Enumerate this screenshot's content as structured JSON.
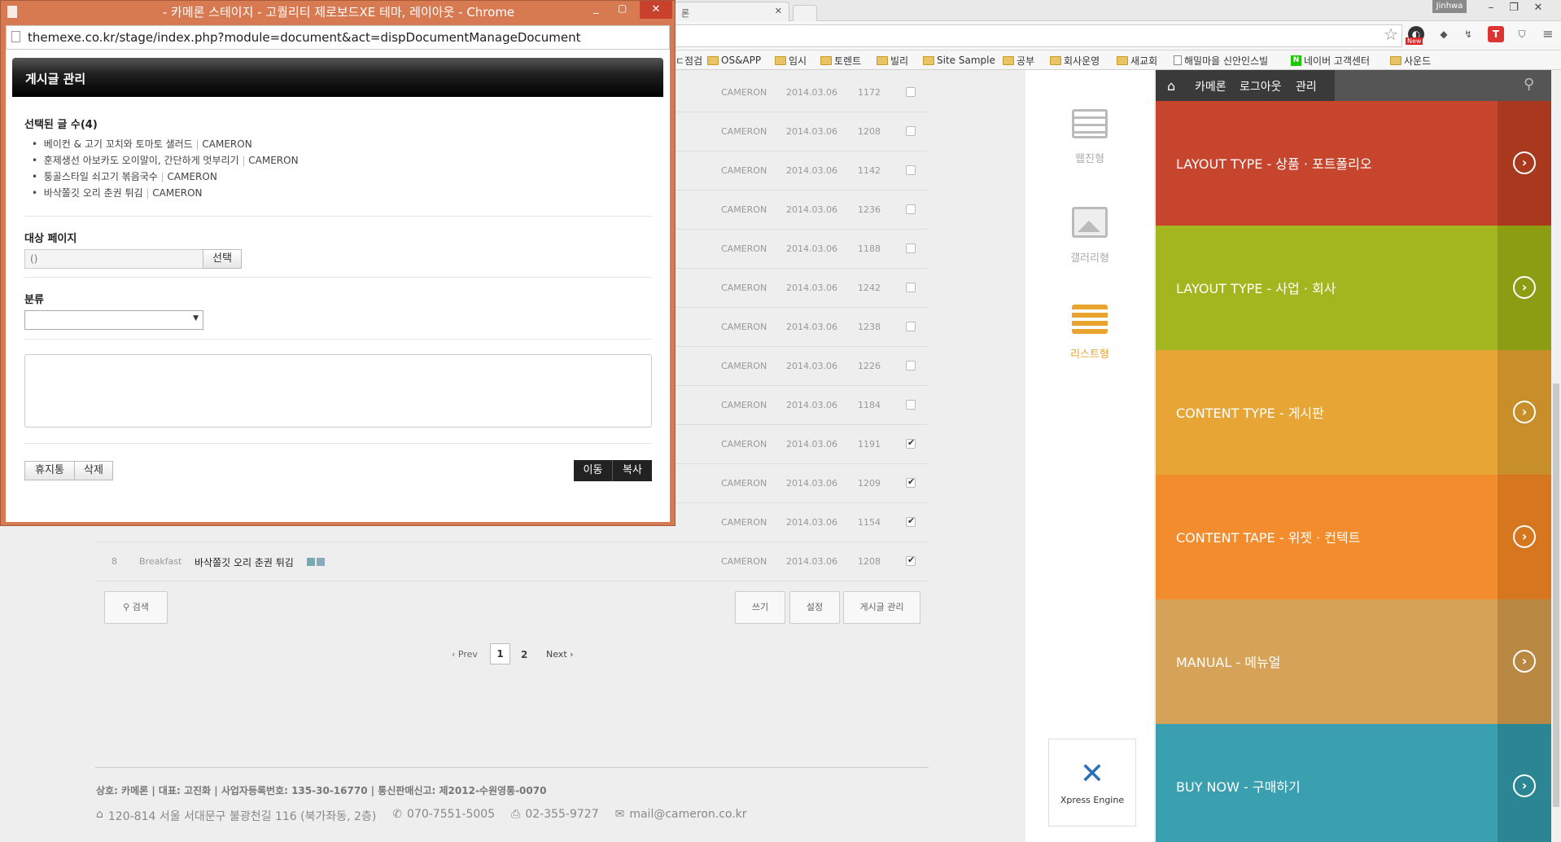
{
  "popup": {
    "window_title": "- 카메론 스테이지 - 고퀄리티 제로보드XE 테마, 레이아웃 - Chrome",
    "url": "themexe.co.kr/stage/index.php?module=document&act=dispDocumentManageDocument",
    "header": "게시글 관리",
    "selected_label": "선택된 글 수(4)",
    "selected_items": [
      {
        "title": "베이컨 & 고기 꼬치와 토마토 샐러드",
        "author": "CAMERON"
      },
      {
        "title": "훈제생선 아보카도 오이말이, 간단하게 멋부리기",
        "author": "CAMERON"
      },
      {
        "title": "퉁골스타일 쇠고기 볶음국수",
        "author": "CAMERON"
      },
      {
        "title": "바삭쫄깃 오리 춘권 튀김",
        "author": "CAMERON"
      }
    ],
    "target_label": "대상 페이지",
    "target_value": "()",
    "select_button": "선택",
    "category_label": "분류",
    "category_value": "",
    "textarea_value": "",
    "trash_button": "휴지통",
    "delete_button": "삭제",
    "move_button": "이동",
    "copy_button": "복사"
  },
  "browser": {
    "tab2_label": "론",
    "user_badge": "Jinhwa",
    "bookmarks": [
      "ㄷ점검",
      "OS&APP",
      "임시",
      "토렌트",
      "빌리",
      "Site Sample",
      "공부",
      "회사운영",
      "새교회",
      "해밀마을 신안인스빌",
      "네이버 고객센터",
      "사운드"
    ],
    "ext_badge": "New"
  },
  "board": {
    "rows": [
      {
        "author": "CAMERON",
        "date": "2014.03.06",
        "views": "1172",
        "checked": false
      },
      {
        "author": "CAMERON",
        "date": "2014.03.06",
        "views": "1208",
        "checked": false
      },
      {
        "author": "CAMERON",
        "date": "2014.03.06",
        "views": "1142",
        "checked": false
      },
      {
        "author": "CAMERON",
        "date": "2014.03.06",
        "views": "1236",
        "checked": false
      },
      {
        "author": "CAMERON",
        "date": "2014.03.06",
        "views": "1188",
        "checked": false
      },
      {
        "author": "CAMERON",
        "date": "2014.03.06",
        "views": "1242",
        "checked": false
      },
      {
        "author": "CAMERON",
        "date": "2014.03.06",
        "views": "1238",
        "checked": false
      },
      {
        "author": "CAMERON",
        "date": "2014.03.06",
        "views": "1226",
        "checked": false
      },
      {
        "author": "CAMERON",
        "date": "2014.03.06",
        "views": "1184",
        "checked": false
      },
      {
        "author": "CAMERON",
        "date": "2014.03.06",
        "views": "1191",
        "checked": true
      },
      {
        "author": "CAMERON",
        "date": "2014.03.06",
        "views": "1209",
        "checked": true
      },
      {
        "author": "CAMERON",
        "date": "2014.03.06",
        "views": "1154",
        "checked": true
      }
    ],
    "last_row": {
      "no": "8",
      "category": "Breakfast",
      "title": "바삭쫄깃 오리 춘권 튀김",
      "author": "CAMERON",
      "date": "2014.03.06",
      "views": "1208",
      "checked": true
    },
    "search_button": "검색",
    "write_button": "쓰기",
    "settings_button": "설정",
    "manage_button": "게시글 관리",
    "pager": {
      "prev": "‹ Prev",
      "pages": [
        "1",
        "2"
      ],
      "current": "1",
      "next": "Next ›"
    },
    "footer_line1": "상호: 카메론 | 대표: 고진화 | 사업자등록번호: 135-30-16770 | 통신판매신고: 제2012-수원영통-0070",
    "footer_address": "120-814 서울 서대문구 불광천길 116 (북가좌동, 2층)",
    "footer_phone": "070-7551-5005",
    "footer_fax": "02-355-9727",
    "footer_email": "mail@cameron.co.kr"
  },
  "side": {
    "items": [
      {
        "label": "웹진형"
      },
      {
        "label": "갤러리형"
      },
      {
        "label": "리스트형"
      }
    ],
    "xe_label": "Xpress Engine"
  },
  "right": {
    "nav": [
      "카메론",
      "로그아웃",
      "관리"
    ],
    "tiles": [
      {
        "label": "LAYOUT TYPE - 상품 · 포트폴리오",
        "color": "#c6452c",
        "dark": "#a8391f"
      },
      {
        "label": "LAYOUT TYPE - 사업 · 회사",
        "color": "#a3b51f",
        "dark": "#8c9d14"
      },
      {
        "label": "CONTENT TYPE - 게시판",
        "color": "#e6a535",
        "dark": "#c88e2a"
      },
      {
        "label": "CONTENT TAPE - 위젯 · 컨텍트",
        "color": "#f28c2c",
        "dark": "#d6761e"
      },
      {
        "label": "MANUAL - 메뉴얼",
        "color": "#d6a257",
        "dark": "#b98842"
      },
      {
        "label": "BUY NOW - 구매하기",
        "color": "#3aa0b0",
        "dark": "#2b8593"
      }
    ]
  }
}
